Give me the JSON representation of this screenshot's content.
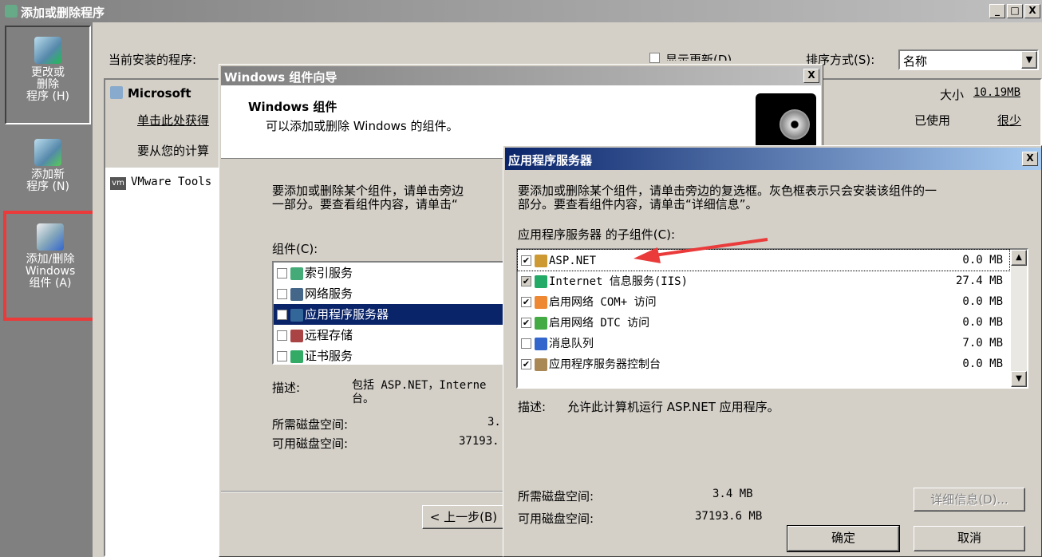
{
  "main_window": {
    "title": "添加或删除程序",
    "controls": [
      "_",
      "□",
      "X"
    ]
  },
  "sidebar": {
    "items": [
      {
        "label": "更改或\n删除\n程序 (H)"
      },
      {
        "label": "添加新\n程序 (N)"
      },
      {
        "label": "添加/删除\nWindows\n组件 (A)"
      }
    ]
  },
  "programs": {
    "header": "当前安装的程序:",
    "show_updates": "显示更新(D)",
    "sort_label": "排序方式(S):",
    "sort_value": "名称",
    "selected": {
      "name": "Microsoft",
      "link": "单击此处获得",
      "text": "要从您的计算",
      "size_label": "大小",
      "size_value": "10.19MB",
      "used_label": "已使用",
      "used_value": "很少"
    },
    "other": "VMware Tools"
  },
  "wizard": {
    "title": "Windows 组件向导",
    "heading": "Windows 组件",
    "subheading": "可以添加或删除 Windows 的组件。",
    "instructions": "要添加或删除某个组件，请单击旁边\n一部分。要查看组件内容，请单击“",
    "components_label": "组件(C):",
    "components": [
      {
        "label": "索引服务",
        "checked": false,
        "icon": "search-icon",
        "color": "#4a7"
      },
      {
        "label": "网络服务",
        "checked": false,
        "icon": "network-icon",
        "color": "#468"
      },
      {
        "label": "应用程序服务器",
        "checked": true,
        "icon": "server-icon",
        "color": "#369",
        "selected": true
      },
      {
        "label": "远程存储",
        "checked": false,
        "icon": "storage-icon",
        "color": "#a44"
      },
      {
        "label": "证书服务",
        "checked": false,
        "icon": "certificate-icon",
        "color": "#3a6"
      }
    ],
    "desc_label": "描述:",
    "desc_text": "包括 ASP.NET，Interne\n台。",
    "req_label": "所需磁盘空间:",
    "req_value": "3.",
    "avail_label": "可用磁盘空间:",
    "avail_value": "37193.",
    "back_button": "< 上一步(B)"
  },
  "dialog": {
    "title": "应用程序服务器",
    "instructions": "要添加或删除某个组件，请单击旁边的复选框。灰色框表示只会安装该组件的一\n部分。要查看组件内容，请单击“详细信息”。",
    "sub_label": "应用程序服务器 的子组件(C):",
    "items": [
      {
        "label": "ASP.NET",
        "size": "0.0 MB",
        "checked": true,
        "icon": "gear-icon",
        "color": "#c93"
      },
      {
        "label": "Internet 信息服务(IIS)",
        "size": "27.4 MB",
        "checked": true,
        "gray": true,
        "icon": "globe-icon",
        "color": "#2a6"
      },
      {
        "label": "启用网络 COM+ 访问",
        "size": "0.0 MB",
        "checked": true,
        "icon": "com-icon",
        "color": "#e83"
      },
      {
        "label": "启用网络 DTC 访问",
        "size": "0.0 MB",
        "checked": true,
        "icon": "dtc-icon",
        "color": "#4a4"
      },
      {
        "label": "消息队列",
        "size": "7.0 MB",
        "checked": false,
        "icon": "message-icon",
        "color": "#36c"
      },
      {
        "label": "应用程序服务器控制台",
        "size": "0.0 MB",
        "checked": true,
        "icon": "console-icon",
        "color": "#a85"
      }
    ],
    "desc_label": "描述:",
    "desc_text": "允许此计算机运行 ASP.NET 应用程序。",
    "req_label": "所需磁盘空间:",
    "req_value": "3.4 MB",
    "avail_label": "可用磁盘空间:",
    "avail_value": "37193.6 MB",
    "details_button": "详细信息(D)...",
    "ok_button": "确定",
    "cancel_button": "取消"
  }
}
